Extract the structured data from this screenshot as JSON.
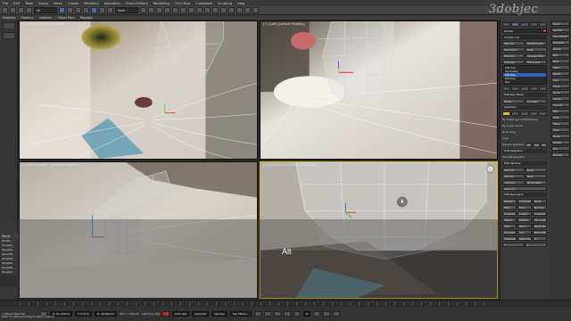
{
  "watermark": "3dobjec",
  "menubar": [
    "File",
    "Edit",
    "Tools",
    "Group",
    "Views",
    "Create",
    "Modifiers",
    "Animation",
    "Graph Editors",
    "Rendering",
    "Civil View",
    "Customize",
    "Scripting",
    "Help"
  ],
  "toolbar": {
    "select_filter": "All",
    "view_mode": "View"
  },
  "ribbon": [
    "Modeling",
    "Freeform",
    "Selection",
    "Object Paint",
    "Populate"
  ],
  "viewports": {
    "top_left": {
      "label": "[+] [Front] [Default Shading]"
    },
    "top_right": {
      "label": "[+] [Left] [Default Shading]"
    },
    "bottom_left": {
      "label": "[+] [Orthographic] [Default Shading]"
    },
    "bottom_right": {
      "label": "[+] [Perspective] [Default Shading]"
    }
  },
  "overlay_text": "Alt",
  "explorer": {
    "header": "Name",
    "rows": [
      "Box001",
      "Plane001",
      "Plane002",
      "Plane003",
      "Plane004",
      "Plane005",
      "Plane006",
      "Plane007"
    ]
  },
  "command_panel": {
    "object_name": "Box001",
    "modifier_list_label": "Modifier List",
    "mod_buttons": [
      "Extrude",
      "TurboSmooth",
      "Symmetry",
      "Shell",
      "Edit Poly",
      "Unwrap UVW",
      "Chamfer",
      "FFD 2x2x2"
    ],
    "stack": [
      "Edit Poly",
      "Symmetry",
      "Edit Poly",
      "Edit Poly",
      "Box"
    ],
    "stack_selected_index": 2,
    "sections": [
      "Edit Poly Mode",
      "Selection",
      "Soft Selection",
      "Edit Vertices",
      "Edit Geometry"
    ],
    "edit_poly_mode": [
      "Model",
      "Animate"
    ],
    "selection_options": [
      "By Vertex",
      "Ignore Backfacing",
      "By Angle:",
      "Shrink",
      "Grow",
      "Ring",
      "Loop"
    ],
    "preview_selection": [
      "Preview Selection",
      "Off",
      "SubObj",
      "Multi"
    ],
    "soft_selection": [
      "Use Soft Selection"
    ],
    "edit_vertices": [
      "Remove",
      "Break",
      "Extrude",
      "Weld",
      "Chamfer",
      "Target Weld",
      "Connect"
    ],
    "edit_geometry": [
      "Repeat Last",
      "Constraints",
      "None",
      "Edge",
      "Face",
      "Normal",
      "Preserve UVs",
      "Create",
      "Collapse",
      "Attach",
      "Detach",
      "Slice Plane",
      "Split",
      "Slice",
      "Reset Plane",
      "QuickSlice",
      "Cut",
      "MSmooth",
      "Tessellate",
      "Make Planar",
      "X",
      "Y",
      "Z"
    ],
    "right_col": [
      "Pivot",
      "Normal",
      "Sub-Object",
      "Selected",
      "Planar",
      "Box",
      "Map",
      "Weld",
      "Reset",
      "Cap",
      "Close",
      "Grow",
      "Shrink",
      "Smooth",
      "Flip",
      "Hide",
      "Show",
      "Copy",
      "Paste",
      "Delete",
      "Full",
      "Named"
    ]
  },
  "status": {
    "selected": "1 Object Selected",
    "prompt": "Click or click-and-drag to select objects",
    "x": "X: 41.061cm",
    "y": "Y: 0.0cm",
    "z": "Z: 40.461cm",
    "grid": "Grid = 10.0cm",
    "auto_key": "Auto Key",
    "selected_mode": "Selected",
    "set_key": "Set Key",
    "key_filters": "Key Filters...",
    "frame": "0",
    "add_time_tag": "Add Time Tag"
  },
  "colors": {
    "selection_blue": "#2f62b8",
    "active_viewport": "#e6c200",
    "red_swatch": "#e02b2b",
    "yellow_swatch": "#e0c21a"
  }
}
